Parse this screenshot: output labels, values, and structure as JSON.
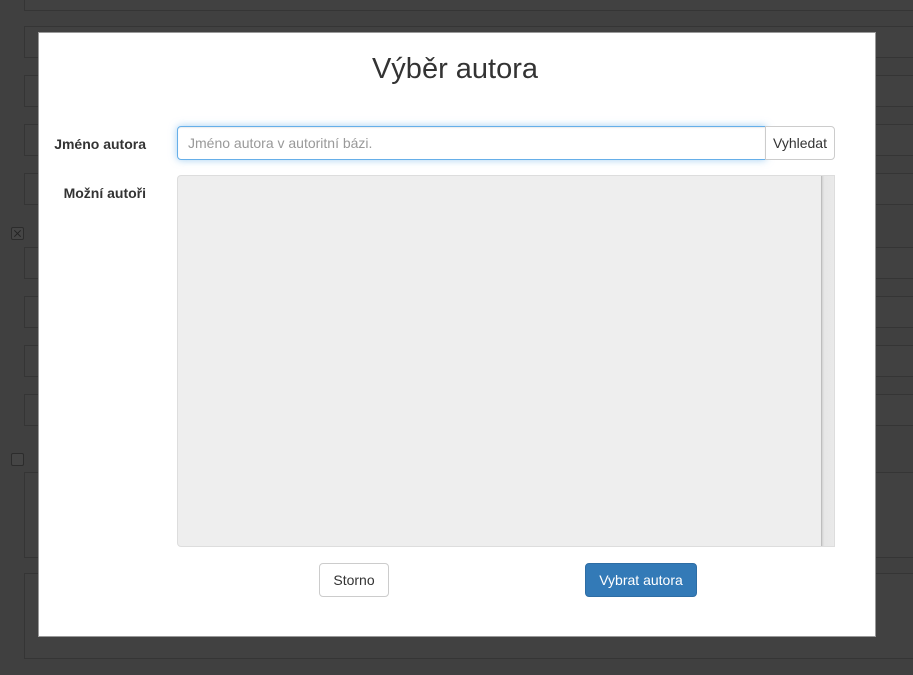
{
  "dialog": {
    "title": "Výběr autora",
    "author_name_label": "Jméno autora",
    "author_name_placeholder": "Jméno autora v autoritní bázi.",
    "author_name_value": "",
    "search_button": "Vyhledat",
    "possible_authors_label": "Možní autoři",
    "possible_authors": [],
    "cancel_button": "Storno",
    "select_button": "Vybrat autora"
  },
  "colors": {
    "primary": "#337ab7",
    "focus_border": "#66afe9",
    "list_background": "#eeeeee",
    "overlay": "#404040"
  }
}
